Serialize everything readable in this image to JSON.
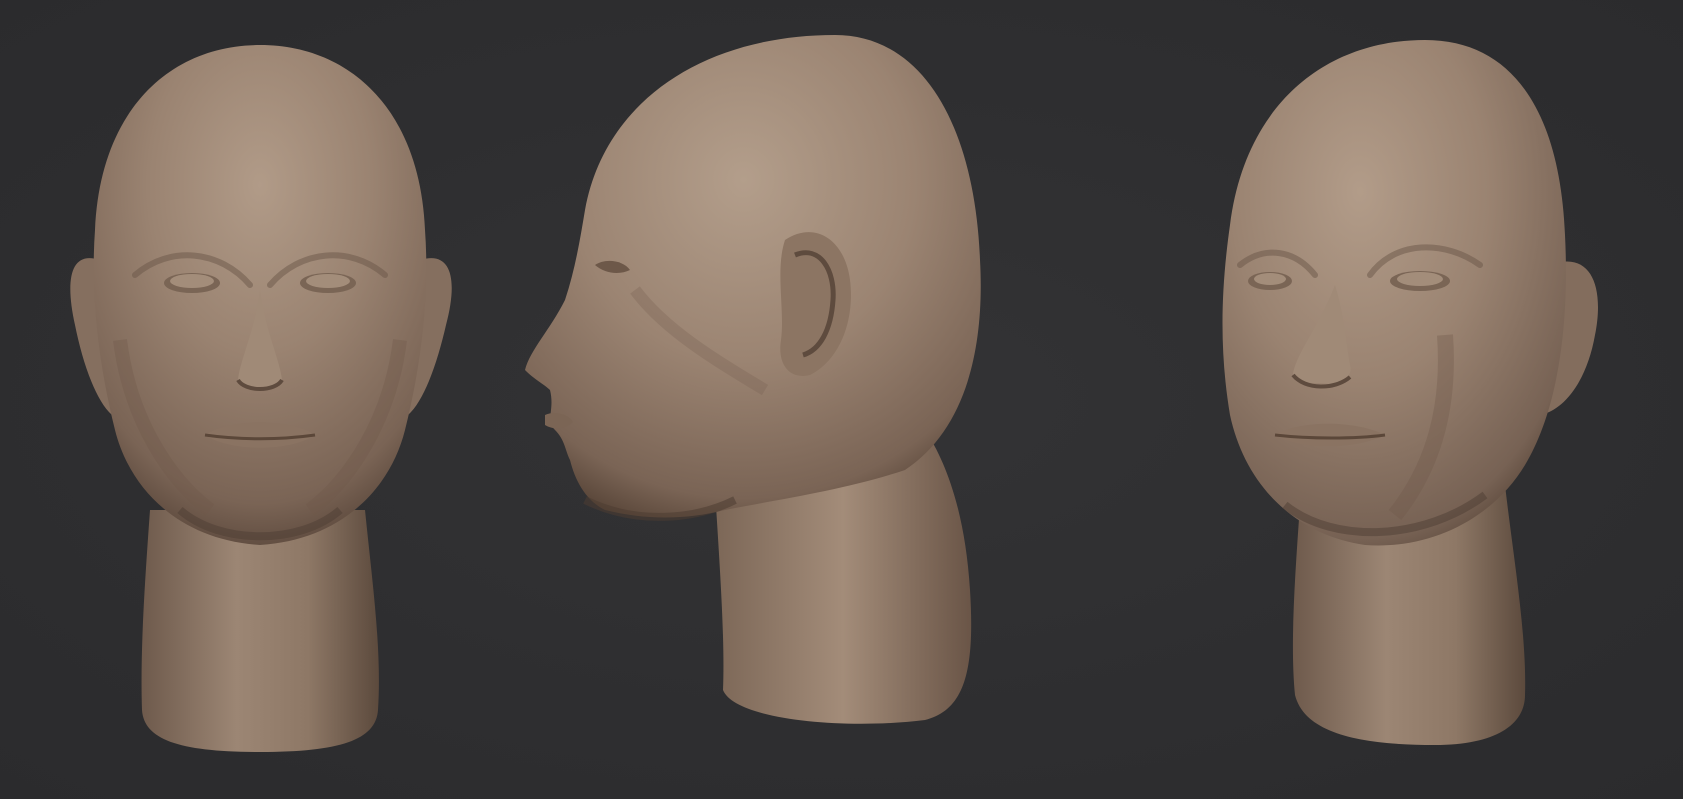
{
  "scene": {
    "background_color": "#2f2f31",
    "skin_base_color": "#9a8270",
    "skin_highlight_color": "#b39d8a",
    "skin_shadow_color": "#5e4b3e"
  },
  "views": [
    {
      "id": "front",
      "name": "front-view"
    },
    {
      "id": "profile",
      "name": "left-profile-view"
    },
    {
      "id": "three-quarter",
      "name": "three-quarter-view"
    }
  ]
}
